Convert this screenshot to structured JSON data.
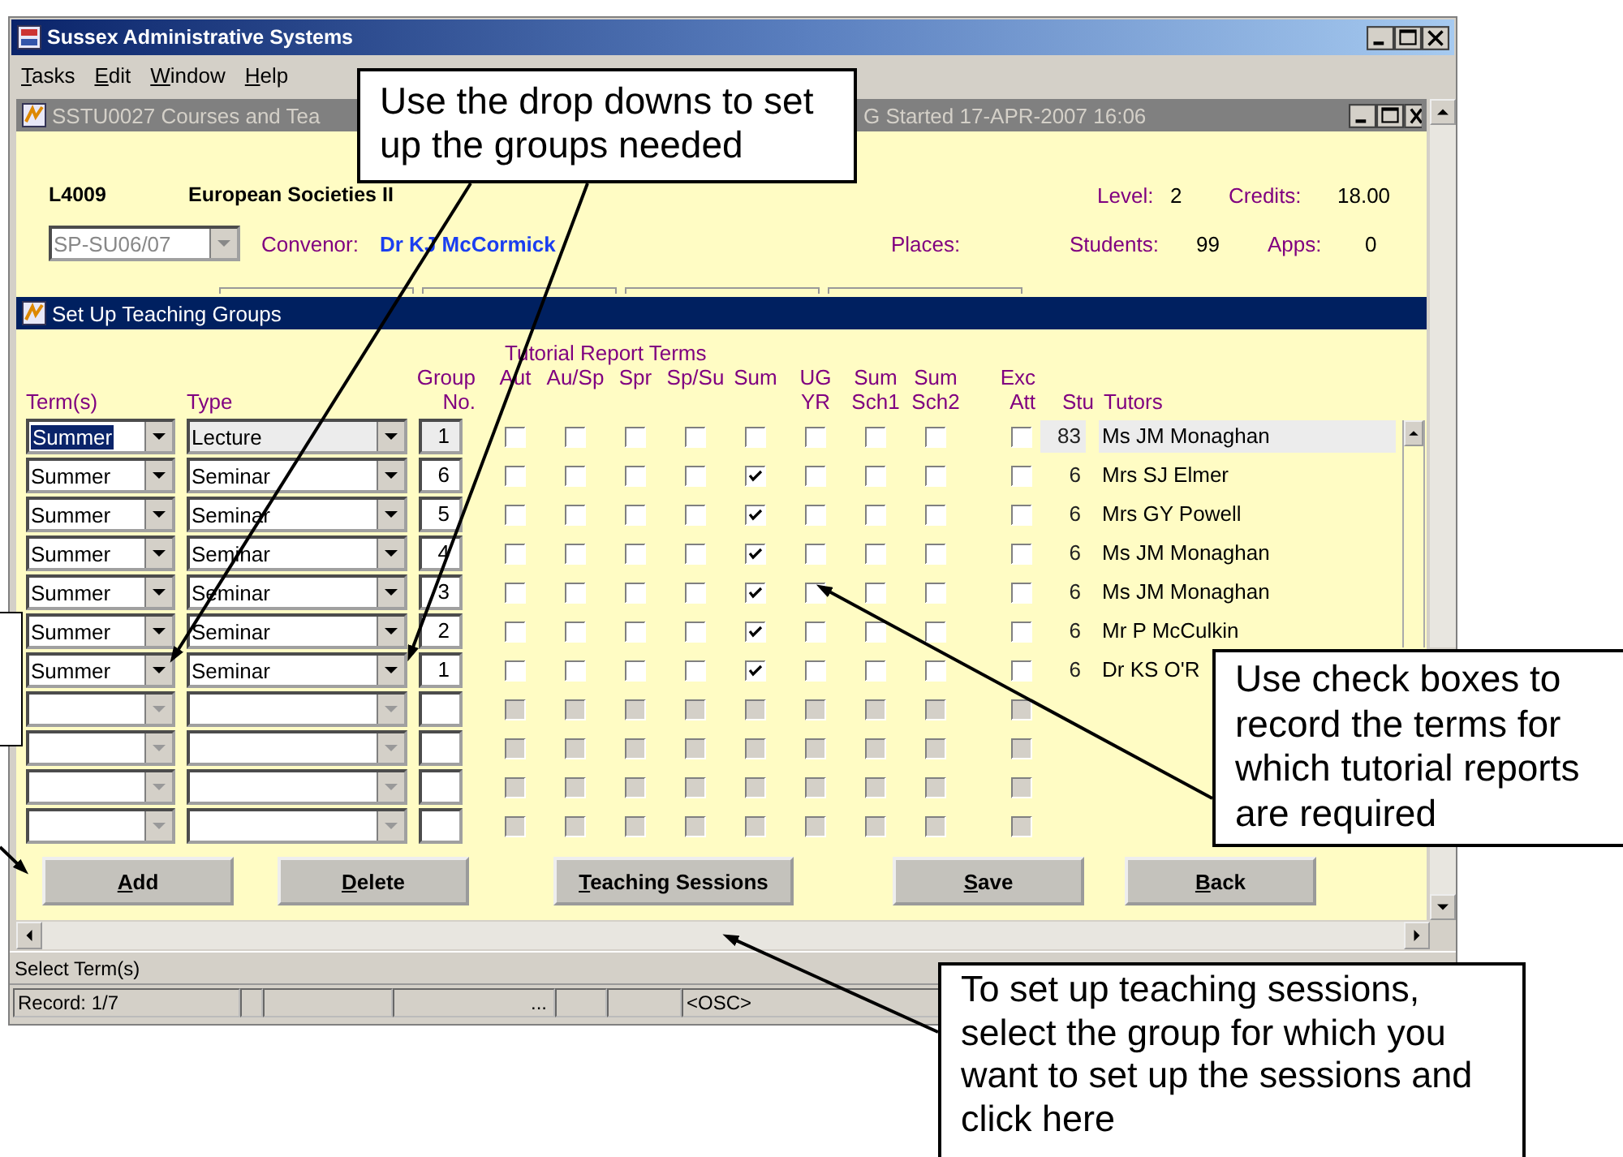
{
  "window": {
    "title": "Sussex Administrative Systems"
  },
  "menu": [
    "Tasks",
    "Edit",
    "Window",
    "Help"
  ],
  "form_window": {
    "title_start": "SSTU0027  Courses and Tea",
    "title_end": "G  Started 17-APR-2007 16:06"
  },
  "course": {
    "code": "L4009",
    "name": "European Societies II",
    "level_label": "Level:",
    "level": "2",
    "credits_label": "Credits:",
    "credits": "18.00",
    "period": "SP-SU06/07",
    "convenor_label": "Convenor:",
    "convenor": "Dr KJ McCormick",
    "places_label": "Places:",
    "students_label": "Students:",
    "students": "99",
    "apps_label": "Apps:",
    "apps": "0"
  },
  "section": {
    "title": "Set Up Teaching Groups"
  },
  "headers": {
    "term": "Term(s)",
    "type": "Type",
    "group_top": "Group",
    "group_bottom": "No.",
    "report_terms": "Tutorial Report Terms",
    "stu": "Stu",
    "tutors": "Tutors",
    "checks": [
      {
        "bottom": "Aut"
      },
      {
        "bottom": "Au/Sp"
      },
      {
        "bottom": "Spr"
      },
      {
        "bottom": "Sp/Su"
      },
      {
        "bottom": "Sum"
      },
      {
        "top": "UG",
        "bottom": "YR"
      },
      {
        "top": "Sum",
        "bottom": "Sch1"
      },
      {
        "top": "Sum",
        "bottom": "Sch2"
      },
      {
        "top": "Exc",
        "bottom": "Att"
      }
    ]
  },
  "rows": [
    {
      "term": "Summer",
      "type": "Lecture",
      "group": "1",
      "checks": [
        false,
        false,
        false,
        false,
        false,
        false,
        false,
        false,
        false
      ],
      "stu": "83",
      "tutor": "Ms JM Monaghan",
      "selected": true
    },
    {
      "term": "Summer",
      "type": "Seminar",
      "group": "6",
      "checks": [
        false,
        false,
        false,
        false,
        true,
        false,
        false,
        false,
        false
      ],
      "stu": "6",
      "tutor": "Mrs SJ Elmer",
      "selected": false
    },
    {
      "term": "Summer",
      "type": "Seminar",
      "group": "5",
      "checks": [
        false,
        false,
        false,
        false,
        true,
        false,
        false,
        false,
        false
      ],
      "stu": "6",
      "tutor": "Mrs GY Powell",
      "selected": false
    },
    {
      "term": "Summer",
      "type": "Seminar",
      "group": "4",
      "checks": [
        false,
        false,
        false,
        false,
        true,
        false,
        false,
        false,
        false
      ],
      "stu": "6",
      "tutor": "Ms JM Monaghan",
      "selected": false
    },
    {
      "term": "Summer",
      "type": "Seminar",
      "group": "3",
      "checks": [
        false,
        false,
        false,
        false,
        true,
        false,
        false,
        false,
        false
      ],
      "stu": "6",
      "tutor": "Ms JM Monaghan",
      "selected": false
    },
    {
      "term": "Summer",
      "type": "Seminar",
      "group": "2",
      "checks": [
        false,
        false,
        false,
        false,
        true,
        false,
        false,
        false,
        false
      ],
      "stu": "6",
      "tutor": "Mr P McCulkin",
      "selected": false
    },
    {
      "term": "Summer",
      "type": "Seminar",
      "group": "1",
      "checks": [
        false,
        false,
        false,
        false,
        true,
        false,
        false,
        false,
        false
      ],
      "stu": "6",
      "tutor": "Dr KS O'R",
      "selected": false
    },
    {
      "disabled": true
    },
    {
      "disabled": true
    },
    {
      "disabled": true
    },
    {
      "disabled": true
    }
  ],
  "buttons": [
    "Add",
    "Delete",
    "Teaching Sessions",
    "Save",
    "Back"
  ],
  "status": "Select Term(s)",
  "record_bar": {
    "record": "Record: 1/7",
    "list_marker": "...",
    "mode": "<OSC>"
  },
  "callouts": [
    {
      "text": "Use the drop downs to set up the groups needed"
    },
    {
      "text": "Use check boxes to record the terms for which tutorial reports are required"
    },
    {
      "text": "To set up teaching sessions, select the group for which you want to set up the sessions and click here"
    }
  ]
}
